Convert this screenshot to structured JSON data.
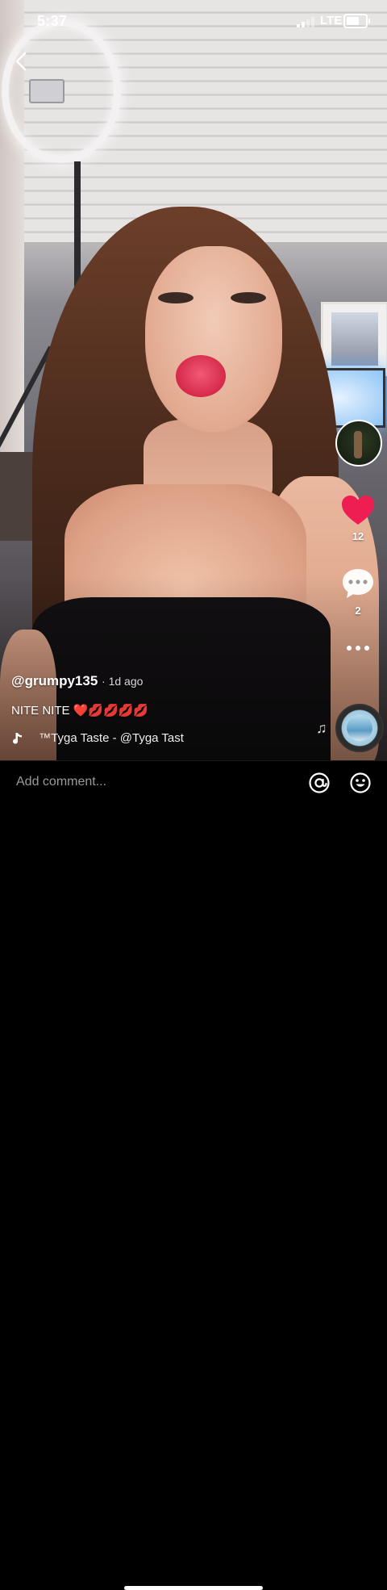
{
  "status_bar": {
    "time": "5:37",
    "network": "LTE",
    "signal_bars": 2,
    "battery_level": 0.7
  },
  "video": {
    "author": "@grumpy135",
    "age": "1d ago",
    "caption": "NITE NITE",
    "caption_emoji": "❤️💋💋💋💋",
    "music_ticker": "™Tyga   Taste - @Tyga   Tast",
    "music_icon": "music-note-icon"
  },
  "actions": {
    "like_count": "12",
    "comment_count": "2",
    "like_color": "#ee1d52"
  },
  "comment_bar": {
    "placeholder": "Add comment..."
  }
}
